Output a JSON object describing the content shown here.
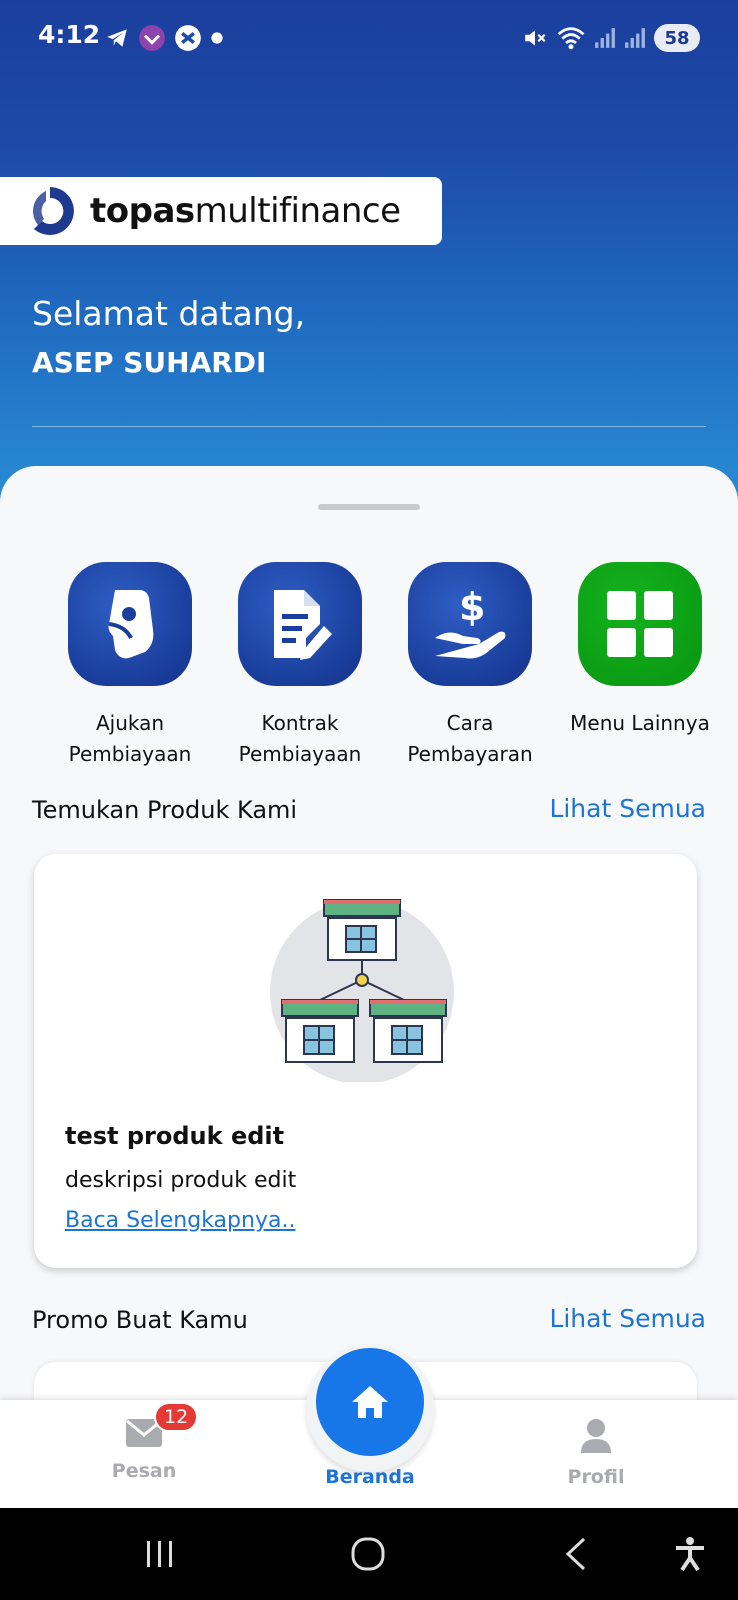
{
  "status_bar": {
    "time": "4:12",
    "battery": "58",
    "left_icons": [
      "telegram-icon",
      "app-icon",
      "xl-icon",
      "dot-icon"
    ],
    "right_icons": [
      "mute-icon",
      "wifi-icon",
      "signal-icon",
      "signal-icon"
    ]
  },
  "brand": {
    "logo_bold": "topas",
    "logo_light": "multifinance",
    "primary_color": "#1d4aa8",
    "accent_color": "#1e73d6"
  },
  "greeting": {
    "welcome": "Selamat datang,",
    "user_name": "ASEP SUHARDI"
  },
  "quick_menu": [
    {
      "label_line1": "Ajukan",
      "label_line2": "Pembiayaan",
      "icon": "hand-money-icon"
    },
    {
      "label_line1": "Kontrak",
      "label_line2": "Pembiayaan",
      "icon": "document-edit-icon"
    },
    {
      "label_line1": "Cara",
      "label_line2": "Pembayaran",
      "icon": "dollar-hand-icon"
    },
    {
      "label_line1": "Menu Lainnya",
      "label_line2": "",
      "icon": "grid-icon"
    }
  ],
  "products_section": {
    "title": "Temukan Produk Kami",
    "link": "Lihat Semua",
    "card": {
      "name": "test produk edit",
      "description": "deskripsi produk edit",
      "read_more": "Baca Selengkapnya.."
    }
  },
  "promo_section": {
    "title": "Promo Buat Kamu",
    "link": "Lihat Semua"
  },
  "bottom_nav": {
    "items": [
      {
        "label": "Pesan",
        "icon": "mail-icon",
        "badge": "12"
      },
      {
        "label": "Beranda",
        "icon": "home-icon",
        "active": true
      },
      {
        "label": "Profil",
        "icon": "person-icon"
      }
    ]
  },
  "system_nav": [
    "recents-icon",
    "home-circle-icon",
    "back-icon",
    "accessibility-icon"
  ]
}
